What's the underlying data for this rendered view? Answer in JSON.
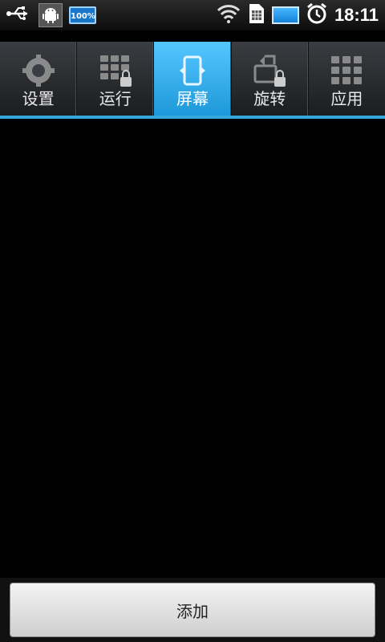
{
  "status_bar": {
    "time": "18:11",
    "battery_text": "100%",
    "icons": [
      "usb-icon",
      "android-debug-icon",
      "battery-100-icon",
      "wifi-icon",
      "sim-icon",
      "battery-icon",
      "alarm-icon"
    ]
  },
  "tabs": [
    {
      "label": "设置",
      "icon": "settings-gear-icon",
      "active": false
    },
    {
      "label": "运行",
      "icon": "grid-lock-icon",
      "active": false
    },
    {
      "label": "屏幕",
      "icon": "screen-rotate-icon",
      "active": true
    },
    {
      "label": "旋转",
      "icon": "rotate-lock-icon",
      "active": false
    },
    {
      "label": "应用",
      "icon": "apps-grid-icon",
      "active": false
    }
  ],
  "bottom": {
    "add_label": "添加"
  },
  "colors": {
    "accent": "#34a7df",
    "active_tab_top": "#55c7ff",
    "active_tab_bottom": "#1e98d9"
  }
}
